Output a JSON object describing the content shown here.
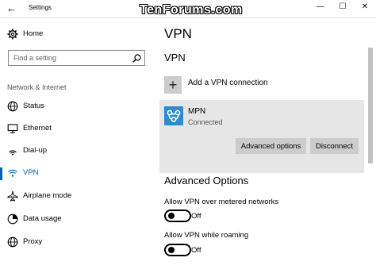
{
  "titlebar": {
    "back_icon": "back-arrow-icon",
    "title": "Settings",
    "watermark": "TenForums.com",
    "controls": [
      "minimize-icon",
      "maximize-icon",
      "close-icon"
    ]
  },
  "sidebar": {
    "home_label": "Home",
    "search_placeholder": "Find a setting",
    "section_label": "Network & Internet",
    "items": [
      {
        "label": "Status",
        "icon": "globe-icon"
      },
      {
        "label": "Ethernet",
        "icon": "monitor-icon"
      },
      {
        "label": "Dial-up",
        "icon": "dialup-icon"
      },
      {
        "label": "VPN",
        "icon": "vpn-icon",
        "active": true
      },
      {
        "label": "Airplane mode",
        "icon": "airplane-icon"
      },
      {
        "label": "Data usage",
        "icon": "data-usage-icon"
      },
      {
        "label": "Proxy",
        "icon": "globe-icon"
      }
    ],
    "accent_color": "#0063b1"
  },
  "main": {
    "title": "VPN",
    "vpn_heading": "VPN",
    "add_label": "Add a VPN connection",
    "connection": {
      "name": "MPN",
      "status": "Connected",
      "advanced_button": "Advanced options",
      "disconnect_button": "Disconnect",
      "icon_color": "#2d8bd1"
    },
    "advanced_heading": "Advanced Options",
    "options": [
      {
        "label": "Allow VPN over metered networks",
        "state": "Off"
      },
      {
        "label": "Allow VPN while roaming",
        "state": "Off"
      }
    ]
  }
}
